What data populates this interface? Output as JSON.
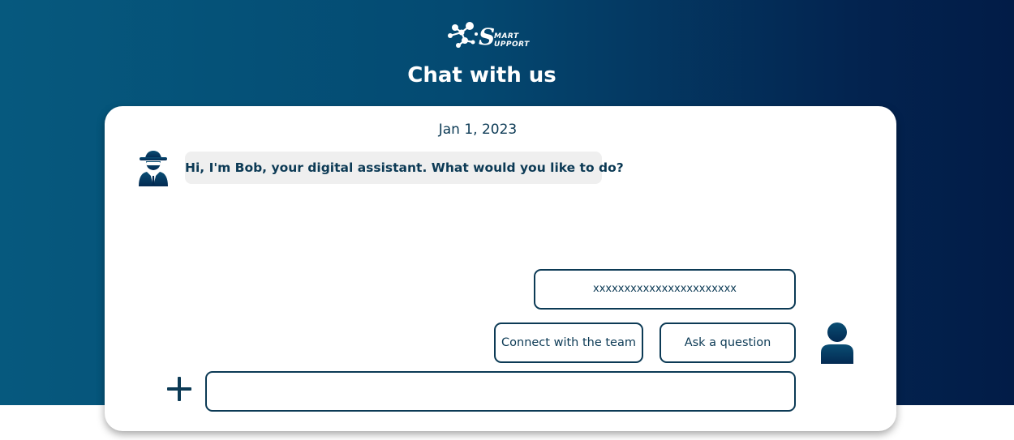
{
  "brand": {
    "logo_big_letter": "S",
    "logo_word_1": "MART",
    "logo_word_2": "UPPORT"
  },
  "header": {
    "title": "Chat with us"
  },
  "chat": {
    "date": "Jan 1, 2023",
    "bot_message": "Hi, I'm Bob, your digital assistant. What would you like to do?",
    "options": {
      "masked": "xxxxxxxxxxxxxxxxxxxxxxx",
      "connect": "Connect with the team",
      "ask": "Ask a question"
    }
  },
  "composer": {
    "value": "",
    "placeholder": ""
  },
  "icons": {
    "bot": "spy-agent-icon",
    "user": "user-icon",
    "add": "plus-icon"
  },
  "colors": {
    "primary": "#0c3a55",
    "gradient_start": "#06597e",
    "gradient_end": "#021c47",
    "bubble_bg": "#efefef"
  }
}
